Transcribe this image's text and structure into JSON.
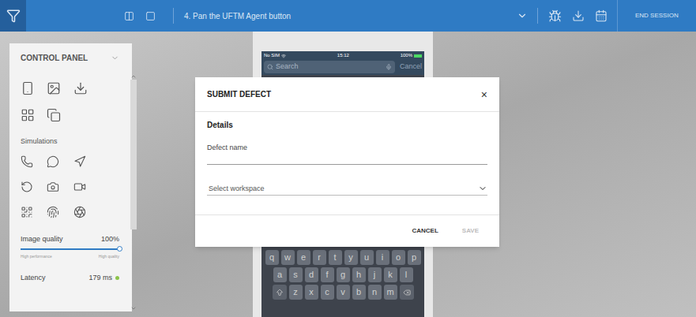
{
  "topbar": {
    "step": "4. Pan the UFTM Agent button",
    "end_session": "END SESSION"
  },
  "control_panel": {
    "title": "CONTROL PANEL",
    "section": "Simulations",
    "image_quality": {
      "label": "Image quality",
      "reading": "100%",
      "level": 1.0,
      "min_label": "High performance",
      "max_label": "High quality"
    },
    "latency": {
      "label": "Latency",
      "reading": "179 ms",
      "color": "#8bc34a"
    }
  },
  "phone": {
    "carrier": "No SIM",
    "time": "15:12",
    "battery": "100%",
    "search_placeholder": "Search",
    "cancel": "Cancel",
    "keyboard": [
      [
        "q",
        "w",
        "e",
        "r",
        "t",
        "y",
        "u",
        "i",
        "o",
        "p"
      ],
      [
        "a",
        "s",
        "d",
        "f",
        "g",
        "h",
        "j",
        "k",
        "l"
      ],
      [
        "z",
        "x",
        "c",
        "v",
        "b",
        "n",
        "m"
      ]
    ]
  },
  "dialog": {
    "title": "SUBMIT DEFECT",
    "close": "×",
    "section": "Details",
    "defect_name_label": "Defect name",
    "defect_name_value": "",
    "workspace_placeholder": "Select workspace",
    "buttons": [
      {
        "label": "CANCEL",
        "disabled": false
      },
      {
        "label": "SAVE",
        "disabled": true
      }
    ]
  }
}
